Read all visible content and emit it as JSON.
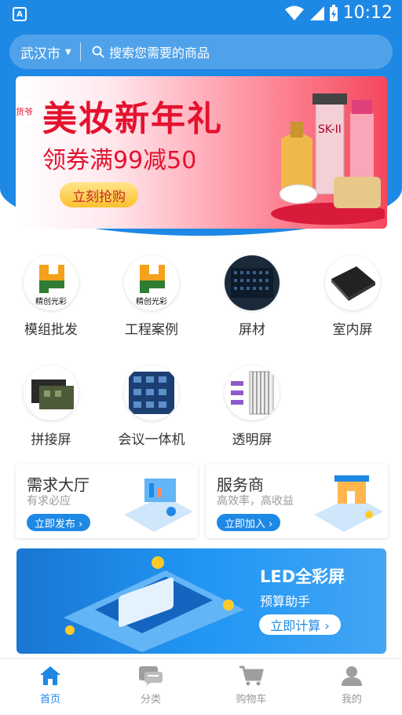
{
  "status": {
    "time": "10:12",
    "app_icon": "A"
  },
  "search": {
    "city": "武汉市",
    "placeholder": "搜索您需要的商品"
  },
  "banner": {
    "tag": "货爷",
    "title": "美妆新年礼",
    "subtitle": "领券满99减50",
    "button": "立刻抢购",
    "dots": 3,
    "active_dot": 1
  },
  "categories": [
    {
      "label": "模组批发",
      "icon": "logo-icon"
    },
    {
      "label": "工程案例",
      "icon": "logo-icon"
    },
    {
      "label": "屏材",
      "icon": "led-panel-icon"
    },
    {
      "label": "室内屏",
      "icon": "led-panel-icon"
    },
    {
      "label": "拼接屏",
      "icon": "module-icon"
    },
    {
      "label": "会议一体机",
      "icon": "circuit-board-icon"
    },
    {
      "label": "透明屏",
      "icon": "transparent-screen-icon"
    }
  ],
  "logo_text": "精创光彩",
  "cards": [
    {
      "title": "需求大厅",
      "subtitle": "有求必应",
      "button": "立即发布 ›"
    },
    {
      "title": "服务商",
      "subtitle": "高效率，高收益",
      "button": "立即加入 ›"
    }
  ],
  "promo": {
    "title": "LED全彩屏",
    "subtitle": "预算助手",
    "button": "立即计算 ›"
  },
  "tabs": [
    {
      "label": "首页",
      "icon": "home-icon",
      "active": true
    },
    {
      "label": "分类",
      "icon": "chat-icon",
      "active": false
    },
    {
      "label": "购物车",
      "icon": "cart-icon",
      "active": false
    },
    {
      "label": "我的",
      "icon": "user-icon",
      "active": false
    }
  ],
  "colors": {
    "primary": "#1e88e5",
    "banner_red": "#e4122f"
  }
}
